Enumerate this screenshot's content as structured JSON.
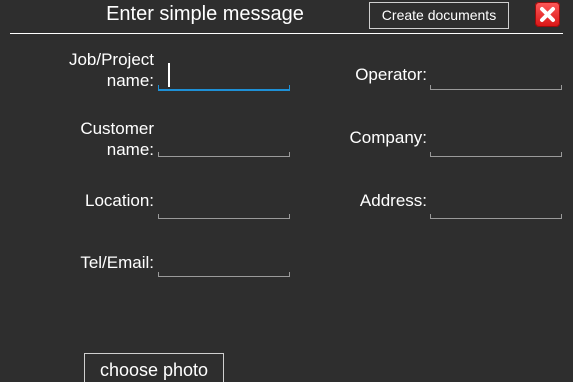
{
  "header": {
    "title": "Enter simple message",
    "create_documents_label": "Create documents",
    "close_icon": "close-icon"
  },
  "form": {
    "left": [
      {
        "key": "job",
        "label_line1": "Job/Project",
        "label_line2": "name:",
        "value": "",
        "focused": true
      },
      {
        "key": "customer",
        "label_line1": "Customer",
        "label_line2": "name:",
        "value": ""
      },
      {
        "key": "location",
        "label": "Location:",
        "value": ""
      },
      {
        "key": "tel",
        "label": "Tel/Email:",
        "value": ""
      }
    ],
    "right": [
      {
        "key": "operator",
        "label": "Operator:",
        "value": ""
      },
      {
        "key": "company",
        "label": "Company:",
        "value": ""
      },
      {
        "key": "address",
        "label": "Address:",
        "value": ""
      }
    ]
  },
  "footer": {
    "choose_photo_label": "choose photo"
  },
  "colors": {
    "background": "#2e2e2e",
    "focus_underline": "#1e90d6",
    "close_red": "#e02020"
  }
}
